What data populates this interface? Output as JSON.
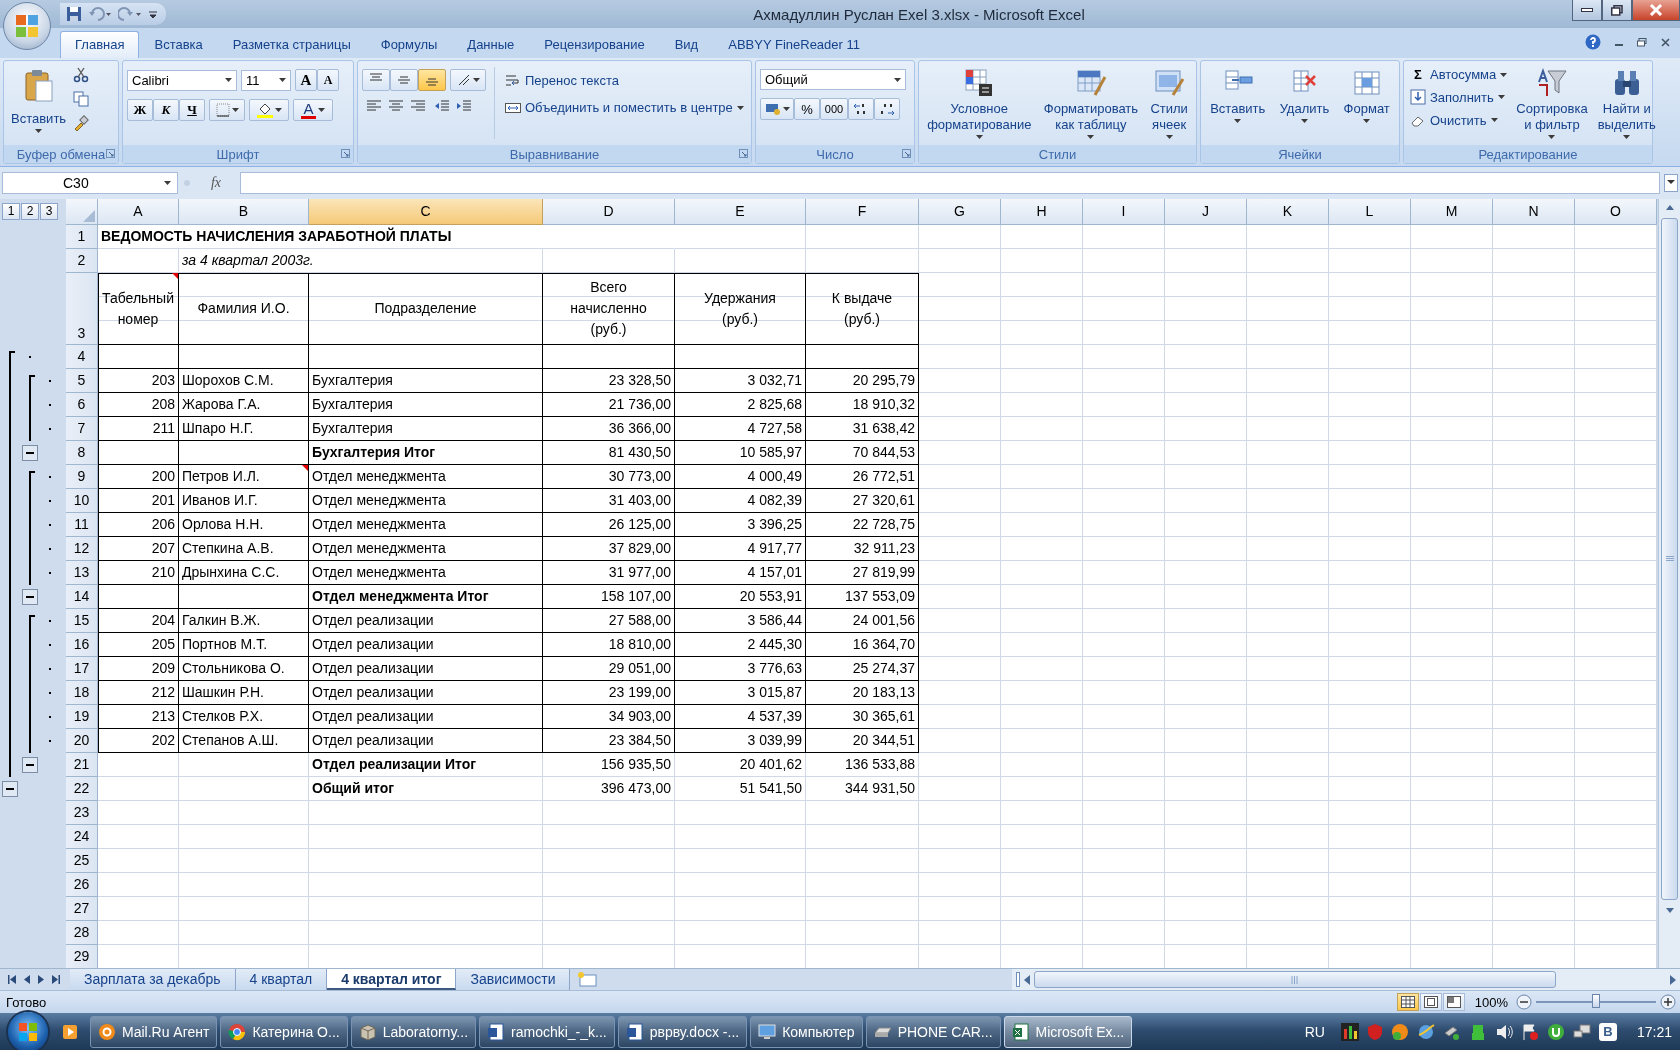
{
  "window": {
    "title": "Ахмадуллин Руслан Exel 3.xlsx - Microsoft Excel"
  },
  "ribbon_tabs": [
    {
      "label": "Главная",
      "selected": true
    },
    {
      "label": "Вставка",
      "selected": false
    },
    {
      "label": "Разметка страницы",
      "selected": false
    },
    {
      "label": "Формулы",
      "selected": false
    },
    {
      "label": "Данные",
      "selected": false
    },
    {
      "label": "Рецензирование",
      "selected": false
    },
    {
      "label": "Вид",
      "selected": false
    },
    {
      "label": "ABBYY FineReader 11",
      "selected": false
    }
  ],
  "ribbon_groups": [
    {
      "kind": "clipboard",
      "title": "Буфер обмена",
      "paste": "Вставить"
    },
    {
      "kind": "font",
      "title": "Шрифт",
      "font": "Calibri",
      "size": "11",
      "grow": "A",
      "shrink": "A",
      "styles": [
        "Ж",
        "К",
        "Ч"
      ],
      "font_color": "A"
    },
    {
      "kind": "align",
      "title": "Выравнивание",
      "vertical_align": [
        {
          "selected": false
        },
        {
          "selected": false
        },
        {
          "selected": true
        }
      ],
      "wrap": "Перенос текста",
      "merge": "Объединить и поместить в центре"
    },
    {
      "kind": "number",
      "title": "Число",
      "format": "Общий",
      "percent": "%",
      "thousands": "000"
    },
    {
      "kind": "large",
      "title": "Стили",
      "items": [
        {
          "kind": "conditional",
          "lines": [
            "Условное",
            "форматирование"
          ]
        },
        {
          "kind": "table",
          "lines": [
            "Форматировать",
            "как таблицу"
          ]
        },
        {
          "kind": "cellstyles",
          "lines": [
            "Стили",
            "ячеек"
          ]
        }
      ]
    },
    {
      "kind": "large",
      "title": "Ячейки",
      "items": [
        {
          "kind": "insert",
          "lines": [
            "Вставить"
          ]
        },
        {
          "kind": "delete",
          "lines": [
            "Удалить"
          ]
        },
        {
          "kind": "format",
          "lines": [
            "Формат"
          ]
        }
      ]
    },
    {
      "kind": "edit",
      "title": "Редактирование",
      "small": [
        {
          "kind": "sum",
          "glyph": "Σ",
          "label": "Автосумма"
        },
        {
          "kind": "fill",
          "label": "Заполнить"
        },
        {
          "kind": "clear",
          "label": "Очистить"
        }
      ],
      "items": [
        {
          "kind": "sort",
          "lines": [
            "Сортировка",
            "и фильтр"
          ]
        },
        {
          "kind": "find",
          "lines": [
            "Найти и",
            "выделить"
          ]
        }
      ]
    }
  ],
  "formula_bar": {
    "name_box": "C30",
    "fx": "fx"
  },
  "outline_levels": [
    "1",
    "2",
    "3"
  ],
  "columns": [
    {
      "label": "A",
      "selected": false
    },
    {
      "label": "B",
      "selected": false
    },
    {
      "label": "C",
      "selected": true
    },
    {
      "label": "D",
      "selected": false
    },
    {
      "label": "E",
      "selected": false
    },
    {
      "label": "F",
      "selected": false
    },
    {
      "label": "G",
      "selected": false
    },
    {
      "label": "H",
      "selected": false
    },
    {
      "label": "I",
      "selected": false
    },
    {
      "label": "J",
      "selected": false
    },
    {
      "label": "K",
      "selected": false
    },
    {
      "label": "L",
      "selected": false
    },
    {
      "label": "M",
      "selected": false
    },
    {
      "label": "N",
      "selected": false
    },
    {
      "label": "O",
      "selected": false
    }
  ],
  "rows": [
    {
      "number": "1",
      "kind": "title",
      "text": "ВЕДОМОСТЬ НАЧИСЛЕНИЯ ЗАРАБОТНОЙ ПЛАТЫ"
    },
    {
      "number": "2",
      "kind": "subtitle",
      "text": "за 4 квартал 2003г."
    },
    {
      "number": "3",
      "kind": "header",
      "bordered": true,
      "cells": [
        {
          "text": "Табельный номер",
          "comment": true
        },
        "Фамилия И.О.",
        "Подразделение",
        "Всего\nначисленно\n(руб.)",
        "Удержания\n(руб.)",
        "К выдаче\n(руб.)"
      ]
    },
    {
      "number": "4",
      "kind": "blank",
      "bordered": true,
      "outline": {
        "kind": "dot-outer"
      }
    },
    {
      "number": "5",
      "kind": "data",
      "bordered": true,
      "outline": {
        "kind": "dot-inner"
      },
      "cells": [
        "203",
        "Шорохов С.М.",
        "Бухгалтерия",
        "23 328,50",
        "3 032,71",
        "20 295,79"
      ]
    },
    {
      "number": "6",
      "kind": "data",
      "bordered": true,
      "outline": {
        "kind": "dot-inner"
      },
      "cells": [
        "208",
        "Жарова Г.А.",
        "Бухгалтерия",
        "21 736,00",
        "2 825,68",
        "18 910,32"
      ]
    },
    {
      "number": "7",
      "kind": "data",
      "bordered": true,
      "outline": {
        "kind": "dot-inner"
      },
      "cells": [
        "211",
        "Шпаро Н.Г.",
        "Бухгалтерия",
        "36 366,00",
        "4 727,58",
        "31 638,42"
      ]
    },
    {
      "number": "8",
      "kind": "subtotal",
      "bordered": true,
      "outline": {
        "kind": "collapse-inner"
      },
      "cells": [
        "Бухгалтерия Итог",
        "81 430,50",
        "10 585,97",
        "70 844,53"
      ]
    },
    {
      "number": "9",
      "kind": "data",
      "bordered": true,
      "outline": {
        "kind": "dot-inner"
      },
      "cells": [
        "200",
        {
          "text": "Петров И.Л.",
          "comment": true
        },
        "Отдел менеджмента",
        "30 773,00",
        "4 000,49",
        "26 772,51"
      ]
    },
    {
      "number": "10",
      "kind": "data",
      "bordered": true,
      "outline": {
        "kind": "dot-inner"
      },
      "cells": [
        "201",
        "Иванов И.Г.",
        "Отдел менеджмента",
        "31 403,00",
        "4 082,39",
        "27 320,61"
      ]
    },
    {
      "number": "11",
      "kind": "data",
      "bordered": true,
      "outline": {
        "kind": "dot-inner"
      },
      "cells": [
        "206",
        "Орлова Н.Н.",
        "Отдел менеджмента",
        "26 125,00",
        "3 396,25",
        "22 728,75"
      ]
    },
    {
      "number": "12",
      "kind": "data",
      "bordered": true,
      "outline": {
        "kind": "dot-inner"
      },
      "cells": [
        "207",
        "Степкина А.В.",
        "Отдел менеджмента",
        "37 829,00",
        "4 917,77",
        "32 911,23"
      ]
    },
    {
      "number": "13",
      "kind": "data",
      "bordered": true,
      "outline": {
        "kind": "dot-inner"
      },
      "cells": [
        "210",
        "Дрынхина С.С.",
        "Отдел менеджмента",
        "31 977,00",
        "4 157,01",
        "27 819,99"
      ]
    },
    {
      "number": "14",
      "kind": "subtotal",
      "bordered": true,
      "outline": {
        "kind": "collapse-inner"
      },
      "cells": [
        "Отдел менеджмента Итог",
        "158 107,00",
        "20 553,91",
        "137 553,09"
      ]
    },
    {
      "number": "15",
      "kind": "data",
      "bordered": true,
      "outline": {
        "kind": "dot-inner"
      },
      "cells": [
        "204",
        "Галкин В.Ж.",
        "Отдел реализации",
        "27 588,00",
        "3 586,44",
        "24 001,56"
      ]
    },
    {
      "number": "16",
      "kind": "data",
      "bordered": true,
      "outline": {
        "kind": "dot-inner"
      },
      "cells": [
        "205",
        "Портнов М.Т.",
        "Отдел реализации",
        "18 810,00",
        "2 445,30",
        "16 364,70"
      ]
    },
    {
      "number": "17",
      "kind": "data",
      "bordered": true,
      "outline": {
        "kind": "dot-inner"
      },
      "cells": [
        "209",
        "Стольникова О.",
        "Отдел реализации",
        "29 051,00",
        "3 776,63",
        "25 274,37"
      ]
    },
    {
      "number": "18",
      "kind": "data",
      "bordered": true,
      "outline": {
        "kind": "dot-inner"
      },
      "cells": [
        "212",
        "Шашкин Р.Н.",
        "Отдел реализации",
        "23 199,00",
        "3 015,87",
        "20 183,13"
      ]
    },
    {
      "number": "19",
      "kind": "data",
      "bordered": true,
      "outline": {
        "kind": "dot-inner"
      },
      "cells": [
        "213",
        "Стелков Р.Х.",
        "Отдел реализации",
        "34 903,00",
        "4 537,39",
        "30 365,61"
      ]
    },
    {
      "number": "20",
      "kind": "data",
      "bordered": true,
      "outline": {
        "kind": "dot-inner"
      },
      "cells": [
        "202",
        "Степанов А.Ш.",
        "Отдел реализации",
        "23 384,50",
        "3 039,99",
        "20 344,51"
      ]
    },
    {
      "number": "21",
      "kind": "subtotal",
      "outline": {
        "kind": "collapse-inner"
      },
      "cells": [
        "Отдел реализации Итог",
        "156 935,50",
        "20 401,62",
        "136 533,88"
      ]
    },
    {
      "number": "22",
      "kind": "total",
      "outline": {
        "kind": "collapse-outer"
      },
      "cells": [
        "Общий итог",
        "396 473,00",
        "51 541,50",
        "344 931,50"
      ]
    },
    {
      "number": "23",
      "kind": "empty"
    },
    {
      "number": "24",
      "kind": "empty"
    },
    {
      "number": "25",
      "kind": "empty"
    },
    {
      "number": "26",
      "kind": "empty"
    },
    {
      "number": "27",
      "kind": "empty"
    },
    {
      "number": "28",
      "kind": "empty"
    },
    {
      "number": "29",
      "kind": "empty"
    }
  ],
  "sheet_tabs": [
    {
      "label": "Зарплата за декабрь",
      "selected": false
    },
    {
      "label": "4 квартал",
      "selected": false
    },
    {
      "label": "4 квартал итог",
      "selected": true
    },
    {
      "label": "Зависимости",
      "selected": false
    }
  ],
  "status_bar": {
    "text": "Готово",
    "views": [
      {
        "selected": true
      },
      {
        "selected": false
      },
      {
        "selected": false
      }
    ],
    "zoom": "100%",
    "zoom_slider": {
      "level": 0.5
    }
  },
  "taskbar": {
    "items": [
      {
        "kind": "mail",
        "label": "Mail.Ru Агент",
        "selected": false
      },
      {
        "kind": "browser",
        "label": "Катерина О...",
        "selected": false
      },
      {
        "kind": "archive",
        "label": "Laboratorny...",
        "selected": false
      },
      {
        "kind": "document",
        "label": "ramochki_-_k...",
        "selected": false
      },
      {
        "kind": "document",
        "label": "рврву.docx -...",
        "selected": false
      },
      {
        "kind": "computer",
        "label": "Компьютер",
        "selected": false
      },
      {
        "kind": "drive",
        "label": "PHONE CAR...",
        "selected": false
      },
      {
        "kind": "spreadsheet",
        "label": "Microsoft Ex...",
        "selected": true
      }
    ],
    "language": "RU",
    "letter_icon": "В",
    "clock": "17:21"
  }
}
